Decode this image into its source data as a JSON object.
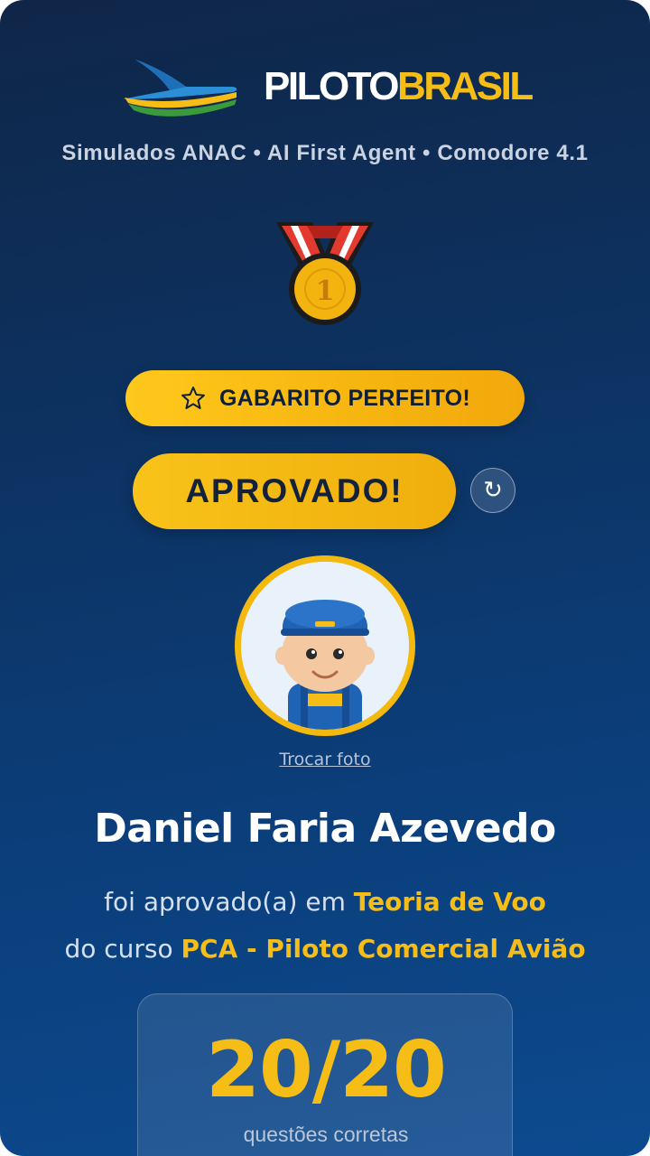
{
  "brand": {
    "name_part1": "PILOTO",
    "name_part2": "BRASIL",
    "logo_icon": "plane-logo-icon",
    "colors": {
      "accent": "#f6bd16",
      "white": "#ffffff",
      "background": "#0d3261",
      "green": "#3a9a3c"
    }
  },
  "subtitle": "Simulados ANAC • AI First Agent • Comodore 4.1",
  "medal": {
    "icon": "first-place-medal-icon",
    "rank": "1"
  },
  "badge": {
    "icon": "star-icon",
    "label": "GABARITO PERFEITO!"
  },
  "result": {
    "label": "APROVADO!",
    "refresh_icon": "refresh-icon",
    "refresh_glyph": "↻"
  },
  "profile": {
    "avatar_icon": "pilot-avatar-icon",
    "change_photo_label": "Trocar foto",
    "name": "Daniel Faria Azevedo"
  },
  "approval": {
    "prefix": "foi aprovado(a) em",
    "subject": "Teoria de Voo",
    "course_prefix": "do curso",
    "course": "PCA - Piloto Comercial Avião"
  },
  "score": {
    "value": "20/20",
    "label": "questões corretas"
  }
}
